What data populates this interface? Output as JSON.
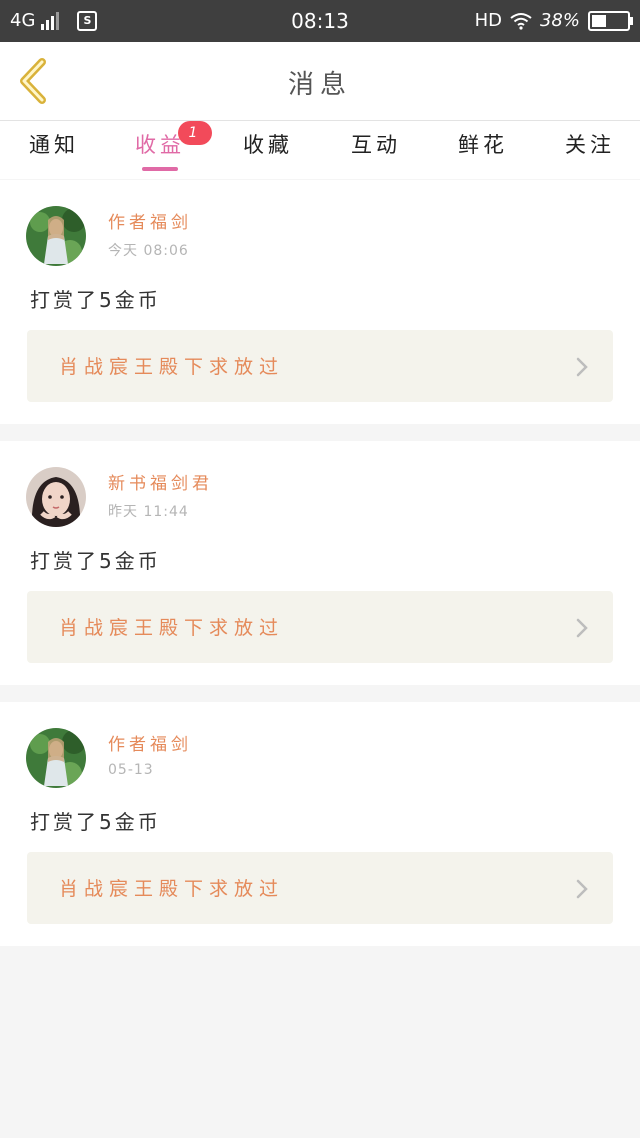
{
  "statusbar": {
    "network": "4G",
    "time": "08:13",
    "hd": "HD",
    "battery": "38%"
  },
  "navbar": {
    "title": "消息"
  },
  "tabs": [
    {
      "label": "通知"
    },
    {
      "label": "收益",
      "badge": "1",
      "active": true
    },
    {
      "label": "收藏"
    },
    {
      "label": "互动"
    },
    {
      "label": "鲜花"
    },
    {
      "label": "关注"
    }
  ],
  "cards": [
    {
      "author": "作者福剑",
      "time": "今天 08:06",
      "message": "打赏了5金币",
      "book": "肖战宸王殿下求放过",
      "avatar": "doll-green-avatar"
    },
    {
      "author": "新书福剑君",
      "time": "昨天 11:44",
      "message": "打赏了5金币",
      "book": "肖战宸王殿下求放过",
      "avatar": "girl-photo-avatar"
    },
    {
      "author": "作者福剑",
      "time": "05-13",
      "message": "打赏了5金币",
      "book": "肖战宸王殿下求放过",
      "avatar": "doll-green-avatar"
    }
  ],
  "colors": {
    "accent": "#e06aa6",
    "author": "#e58a5a",
    "badge": "#f24a5a",
    "back_arrow": "#d9b23a"
  }
}
